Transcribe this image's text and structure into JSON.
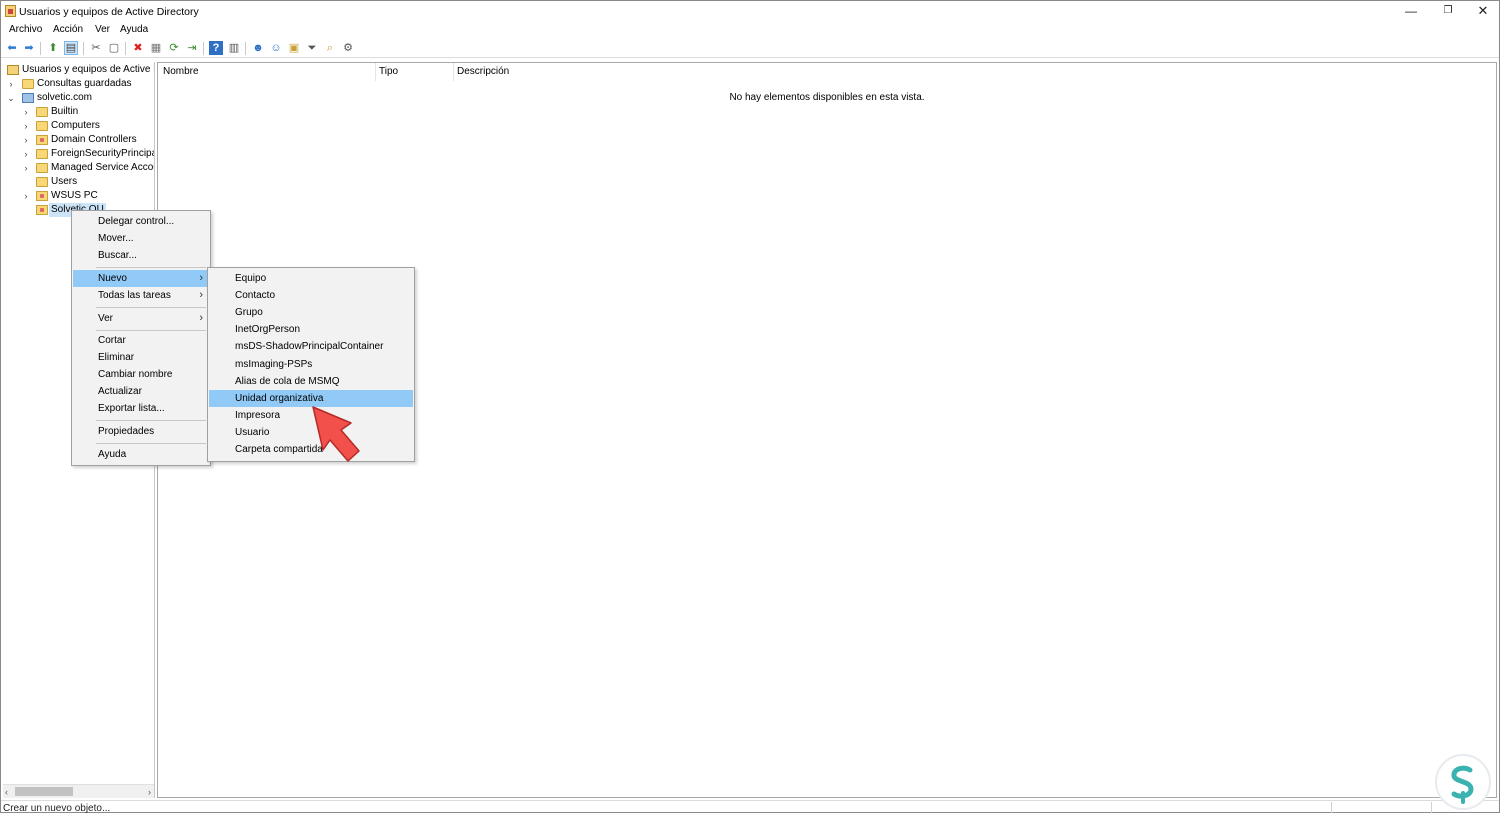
{
  "window": {
    "title": "Usuarios y equipos de Active Directory",
    "controls": {
      "minimize": "—",
      "maximize": "❐",
      "close": "✕"
    }
  },
  "menubar": [
    "Archivo",
    "Acción",
    "Ver",
    "Ayuda"
  ],
  "toolbar": {
    "icons": [
      "back-icon",
      "forward-icon",
      "up-folder-icon",
      "show-tree-icon",
      "cut-icon",
      "copy-icon",
      "delete-icon",
      "properties-icon",
      "refresh-icon",
      "export-icon",
      "help-icon",
      "console-view-icon",
      "new-user-icon",
      "new-group-icon",
      "new-ou-icon",
      "filter-icon",
      "find-icon",
      "add-to-group-icon"
    ]
  },
  "tree": {
    "items": [
      {
        "label": "Usuarios y equipos de Active Dir",
        "expander": "",
        "icon": "root-icon"
      },
      {
        "label": "Consultas guardadas",
        "expander": "›",
        "icon": "folder-icon"
      },
      {
        "label": "solvetic.com",
        "expander": "⌄",
        "icon": "domain-icon"
      },
      {
        "label": "Builtin",
        "expander": "›",
        "icon": "folder-icon"
      },
      {
        "label": "Computers",
        "expander": "›",
        "icon": "folder-icon"
      },
      {
        "label": "Domain Controllers",
        "expander": "›",
        "icon": "ou-folder-icon"
      },
      {
        "label": "ForeignSecurityPrincipals",
        "expander": "›",
        "icon": "folder-icon"
      },
      {
        "label": "Managed Service Accour",
        "expander": "›",
        "icon": "folder-icon"
      },
      {
        "label": "Users",
        "expander": "",
        "icon": "folder-icon"
      },
      {
        "label": "WSUS PC",
        "expander": "›",
        "icon": "ou-folder-icon"
      },
      {
        "label": "Solvetic OU",
        "expander": "",
        "icon": "ou-folder-icon"
      }
    ],
    "scroll_left": "‹",
    "scroll_right": "›"
  },
  "list": {
    "columns": [
      "Nombre",
      "Tipo",
      "Descripción"
    ],
    "empty_message": "No hay elementos disponibles en esta vista."
  },
  "context_menu": {
    "items": [
      {
        "label": "Delegar control..."
      },
      {
        "label": "Mover..."
      },
      {
        "label": "Buscar..."
      },
      {
        "label": "Nuevo",
        "submenu": true,
        "highlighted": true
      },
      {
        "label": "Todas las tareas",
        "submenu": true
      },
      {
        "label": "Ver",
        "submenu": true
      },
      {
        "label": "Cortar"
      },
      {
        "label": "Eliminar"
      },
      {
        "label": "Cambiar nombre"
      },
      {
        "label": "Actualizar"
      },
      {
        "label": "Exportar lista..."
      },
      {
        "label": "Propiedades"
      },
      {
        "label": "Ayuda"
      }
    ],
    "arrow": "›"
  },
  "submenu": {
    "items": [
      {
        "label": "Equipo"
      },
      {
        "label": "Contacto"
      },
      {
        "label": "Grupo"
      },
      {
        "label": "InetOrgPerson"
      },
      {
        "label": "msDS-ShadowPrincipalContainer"
      },
      {
        "label": "msImaging-PSPs"
      },
      {
        "label": "Alias de cola de MSMQ"
      },
      {
        "label": "Unidad organizativa",
        "highlighted": true
      },
      {
        "label": "Impresora"
      },
      {
        "label": "Usuario"
      },
      {
        "label": "Carpeta compartida"
      }
    ]
  },
  "status": {
    "text": "Crear un nuevo objeto..."
  },
  "colors": {
    "highlight": "#91c9f7",
    "menu_bg": "#f2f2f2",
    "pointer_red": "#f2504b",
    "logo_teal": "#39b2b0"
  }
}
